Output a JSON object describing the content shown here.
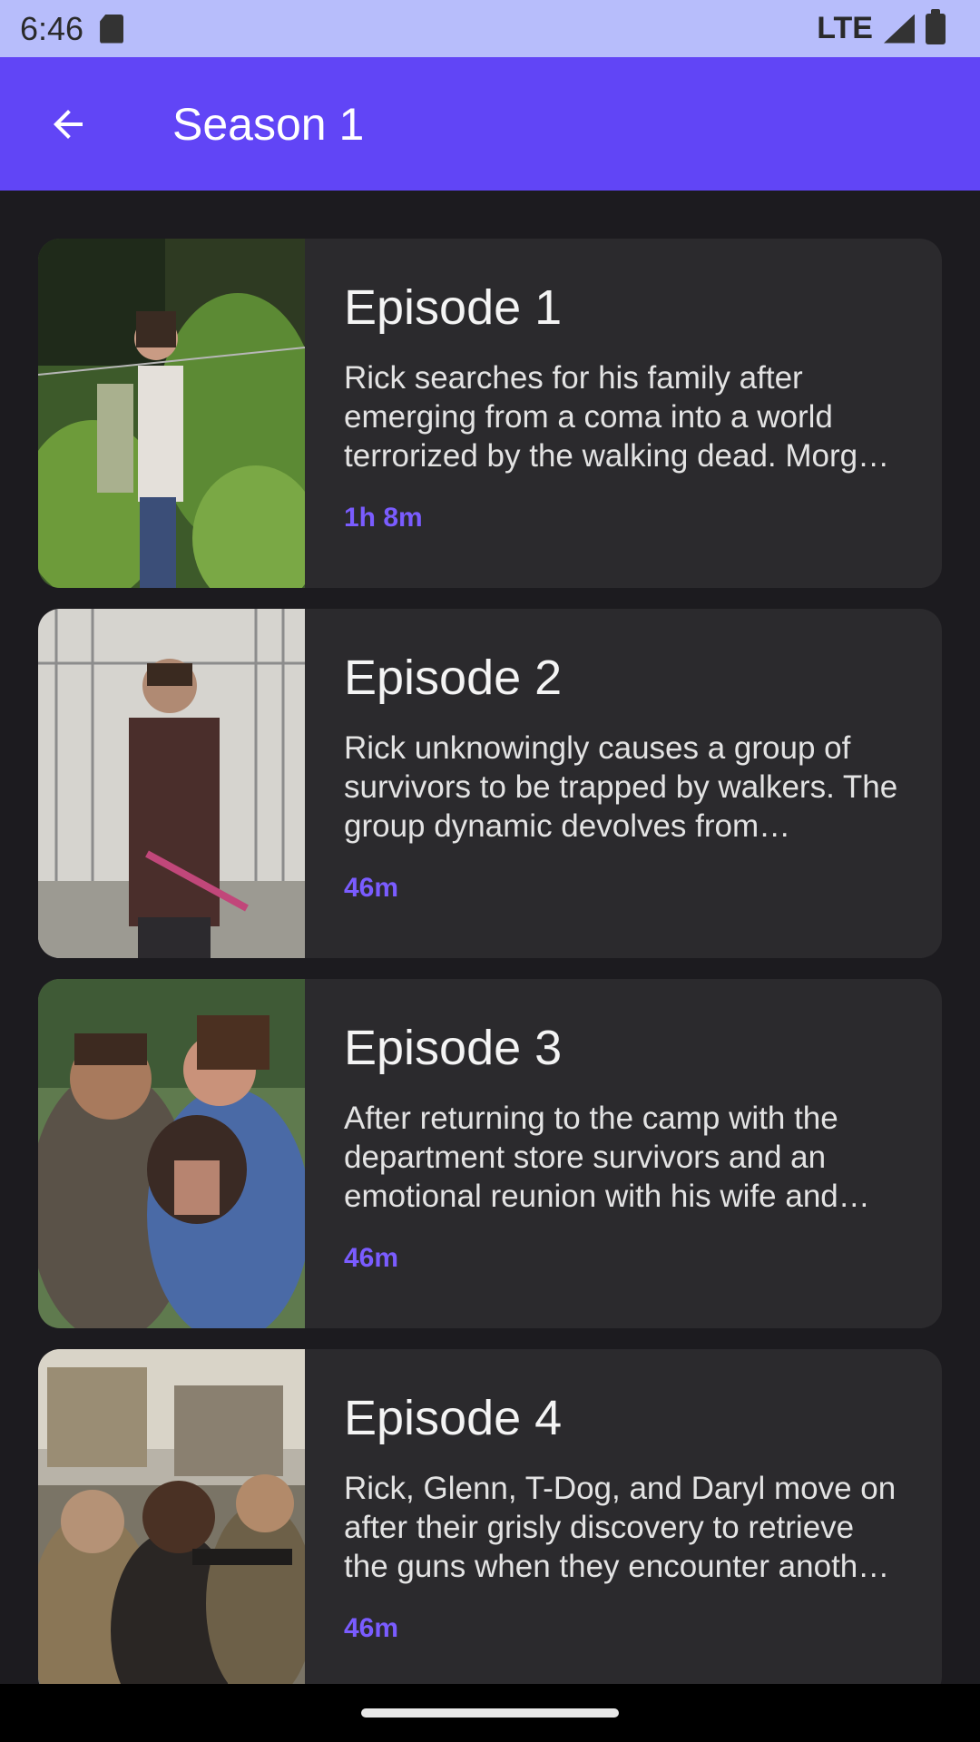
{
  "status_bar": {
    "time": "6:46",
    "network": "LTE",
    "icons": [
      "sd-card-icon",
      "signal-icon",
      "battery-icon"
    ]
  },
  "app_bar": {
    "title": "Season 1",
    "back_icon": "arrow-left-icon"
  },
  "colors": {
    "app_bar": "#6145f6",
    "status_bar": "#b7bdfb",
    "accent": "#7a5cff",
    "card": "#2b2a2d",
    "background": "#1c1b1f"
  },
  "episodes": [
    {
      "title": "Episode 1",
      "description": "Rick searches for his family after emerging from a coma into a world terrorized by the walking dead. Morgan and Duane help Rick find his way.",
      "duration": "1h 8m"
    },
    {
      "title": "Episode 2",
      "description": "Rick unknowingly causes a group of survivors to be trapped by walkers. The group dynamic devolves from accusations to violence.",
      "duration": "46m"
    },
    {
      "title": "Episode 3",
      "description": "After returning to the camp with the department store survivors and an emotional reunion with his wife and son, Rick heads back to Atlanta.",
      "duration": "46m"
    },
    {
      "title": "Episode 4",
      "description": "Rick, Glenn, T-Dog, and Daryl move on after their grisly discovery to retrieve the guns when they encounter another group of survivors.",
      "duration": "46m"
    }
  ]
}
